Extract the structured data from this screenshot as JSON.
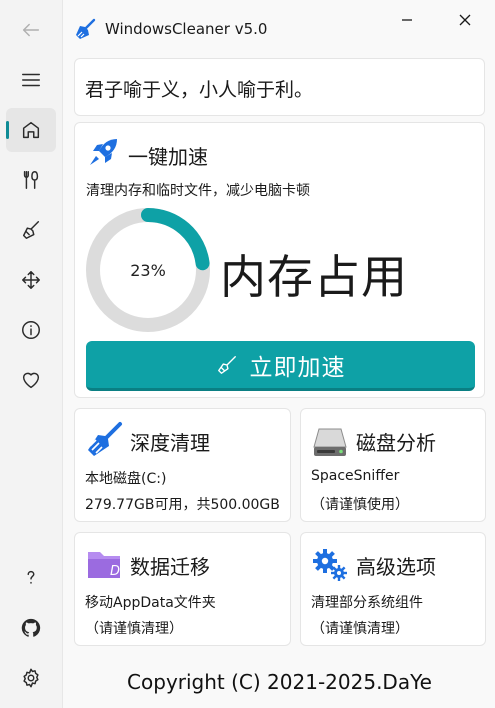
{
  "window": {
    "title": "WindowsCleaner v5.0",
    "minimize_icon": "minimize-icon",
    "close_icon": "close-icon"
  },
  "nav": {
    "items": [
      {
        "name": "back",
        "icon": "back-arrow-icon"
      },
      {
        "name": "menu",
        "icon": "hamburger-menu-icon"
      },
      {
        "name": "home",
        "icon": "home-icon",
        "selected": true
      },
      {
        "name": "tools",
        "icon": "tools-icon"
      },
      {
        "name": "clean",
        "icon": "broom-icon"
      },
      {
        "name": "move",
        "icon": "move-arrows-icon"
      },
      {
        "name": "about",
        "icon": "info-icon"
      },
      {
        "name": "favorite",
        "icon": "heart-icon"
      },
      {
        "name": "help",
        "icon": "question-icon"
      },
      {
        "name": "github",
        "icon": "github-icon"
      },
      {
        "name": "settings",
        "icon": "gear-icon"
      }
    ]
  },
  "quote": "君子喻于义，小人喻于利。",
  "boost": {
    "title": "一键加速",
    "description": "清理内存和临时文件，减少电脑卡顿",
    "memory_percent": 23,
    "memory_percent_label": "23%",
    "memory_label": "内存占用",
    "button_label": "立即加速"
  },
  "cards": [
    {
      "title": "深度清理",
      "lines": [
        "本地磁盘(C:)",
        "279.77GB可用，共500.00GB"
      ],
      "icon": "broom-icon"
    },
    {
      "title": "磁盘分析",
      "lines": [
        "SpaceSniffer",
        "（请谨慎使用）"
      ],
      "icon": "hard-drive-icon"
    },
    {
      "title": "数据迁移",
      "lines": [
        "移动AppData文件夹",
        "（请谨慎清理）"
      ],
      "icon": "folder-icon"
    },
    {
      "title": "高级选项",
      "lines": [
        "清理部分系统组件",
        "（请谨慎清理）"
      ],
      "icon": "gears-icon"
    }
  ],
  "footer": "Copyright (C) 2021-2025.DaYe",
  "colors": {
    "accent": "#0ea1a6",
    "ring_track": "#dcdcdc",
    "icon_blue": "#1e6fe0",
    "folder_purple": "#9b6be0"
  }
}
